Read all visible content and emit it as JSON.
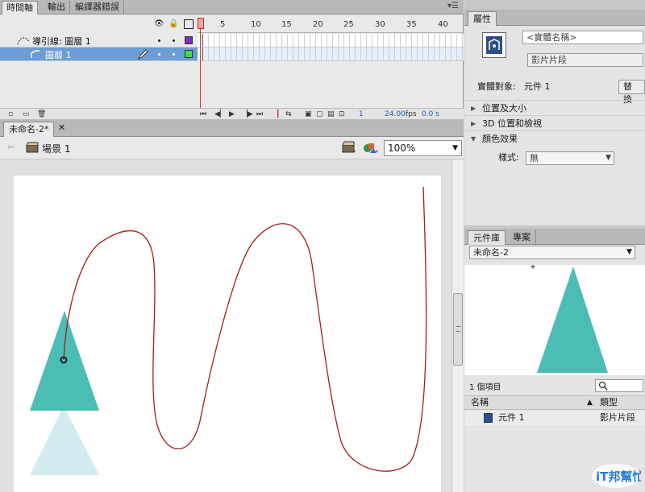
{
  "timeline": {
    "tabs": [
      "時間軸",
      "輸出",
      "編譯器錯誤"
    ],
    "menu_icon": "panel-menu-icon",
    "header_icons": [
      "eye-icon",
      "lock-icon",
      "outline-icon"
    ],
    "frame_numbers": [
      "1",
      "5",
      "10",
      "15",
      "20",
      "25",
      "30",
      "35",
      "40"
    ],
    "layers": [
      {
        "name": "導引線: 圖層 1",
        "outline_color": "#7d2bbf",
        "selected": false
      },
      {
        "name": "圖層 1",
        "outline_color": "#3fdc49",
        "selected": true
      }
    ],
    "status": {
      "current_frame": "1",
      "fps": "24.00",
      "fps_unit": "fps",
      "time": "0.0 s"
    }
  },
  "document": {
    "tab_label": "未命名-2*",
    "close_glyph": "✕",
    "scene_label": "場景 1",
    "zoom": "100%",
    "colors": {
      "triangle": "#4bbdb4",
      "triangle_faded": "#d2ecef",
      "motion_guide": "#a31d1d"
    }
  },
  "properties": {
    "tab_label": "屬性",
    "instance_name_placeholder": "<實體名稱>",
    "symbol_type": "影片片段",
    "instance_of_label": "實體對象:",
    "instance_of_value": "元件 1",
    "swap_button": "替換",
    "sections": [
      {
        "label": "位置及大小",
        "expanded": false
      },
      {
        "label": "3D 位置和檢視",
        "expanded": false
      },
      {
        "label": "顏色效果",
        "expanded": true
      }
    ],
    "style_label": "樣式:",
    "style_value": "無"
  },
  "library": {
    "tabs": [
      "元件庫",
      "專案"
    ],
    "document_select": "未命名-2",
    "item_count": "1 個項目",
    "columns": {
      "name": "名稱",
      "type": "類型"
    },
    "items": [
      {
        "name": "元件 1",
        "type": "影片片段"
      }
    ]
  },
  "watermark": {
    "text": "iT邦幫忙"
  }
}
